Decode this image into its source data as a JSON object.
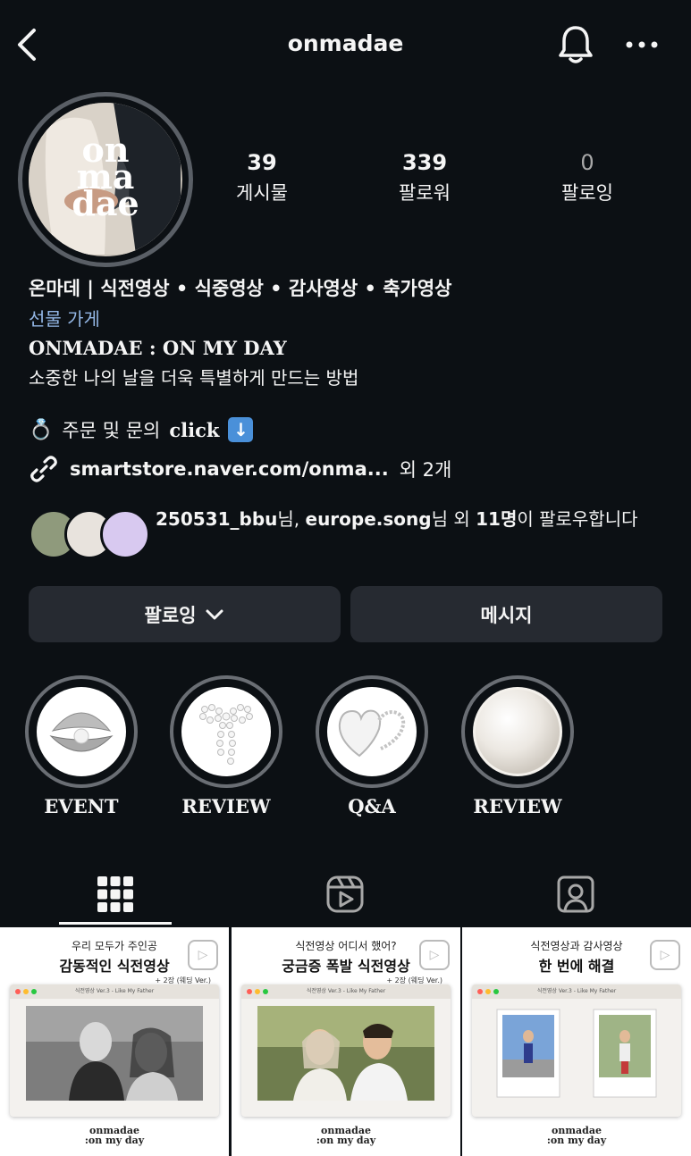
{
  "header": {
    "username": "onmadae"
  },
  "profile": {
    "avatar_logo_lines": [
      "on",
      "ma",
      "dae"
    ],
    "stats": [
      {
        "count": "39",
        "label": "게시물"
      },
      {
        "count": "339",
        "label": "팔로워"
      },
      {
        "count": "0",
        "label": "팔로잉"
      }
    ],
    "bio": {
      "name": "온마데 | 식전영상 • 식중영상 • 감사영상 • 축가영상",
      "category": "선물 가게",
      "brand": "ONMADAE : ON MY DAY",
      "tagline": "소중한 나의 날을 더욱 특별하게 만드는 방법",
      "order_prefix": "주문 및 문의",
      "order_click": "click",
      "link": "smartstore.naver.com/onma...",
      "link_more": "외 2개"
    },
    "followed_by": {
      "user1": "250531_bbu",
      "user2": "europe.song",
      "suffix_1": "님, ",
      "suffix_2": "님 외 ",
      "count": "11명",
      "suffix_3": "이 팔로우합니다"
    }
  },
  "actions": {
    "following_label": "팔로잉",
    "message_label": "메시지"
  },
  "highlights": [
    {
      "label": "EVENT",
      "icon": "pearl-shell-icon"
    },
    {
      "label": "REVIEW",
      "icon": "pearl-bow-icon"
    },
    {
      "label": "Q&A",
      "icon": "pearl-heart-icon"
    },
    {
      "label": "REVIEW",
      "icon": "pearl-icon"
    }
  ],
  "tabs": [
    "grid-icon",
    "reels-icon",
    "tagged-icon"
  ],
  "posts": [
    {
      "line1": "우리 모두가 주인공",
      "line2": "감동적인 식전영상",
      "window_title": "식전영상 Ver.3 - Like My Father",
      "badge": "+ 2장 (웨딩 Ver.)",
      "footer_1": "onmadae",
      "footer_2": ":on my day"
    },
    {
      "line1": "식전영상 어디서 했어?",
      "line2": "궁금증 폭발 식전영상",
      "window_title": "식전영상 Ver.3 - Like My Father",
      "badge": "+ 2장 (웨딩 Ver.)",
      "footer_1": "onmadae",
      "footer_2": ":on my day"
    },
    {
      "line1": "식전영상과 감사영상",
      "line2": "한 번에 해결",
      "window_title": "식전영상 Ver.3 - Like My Father",
      "badge": "",
      "footer_1": "onmadae",
      "footer_2": ":on my day"
    }
  ],
  "colors": {
    "background": "#0c1014",
    "link_blue": "#94b7e6",
    "button_bg": "#262a31"
  }
}
